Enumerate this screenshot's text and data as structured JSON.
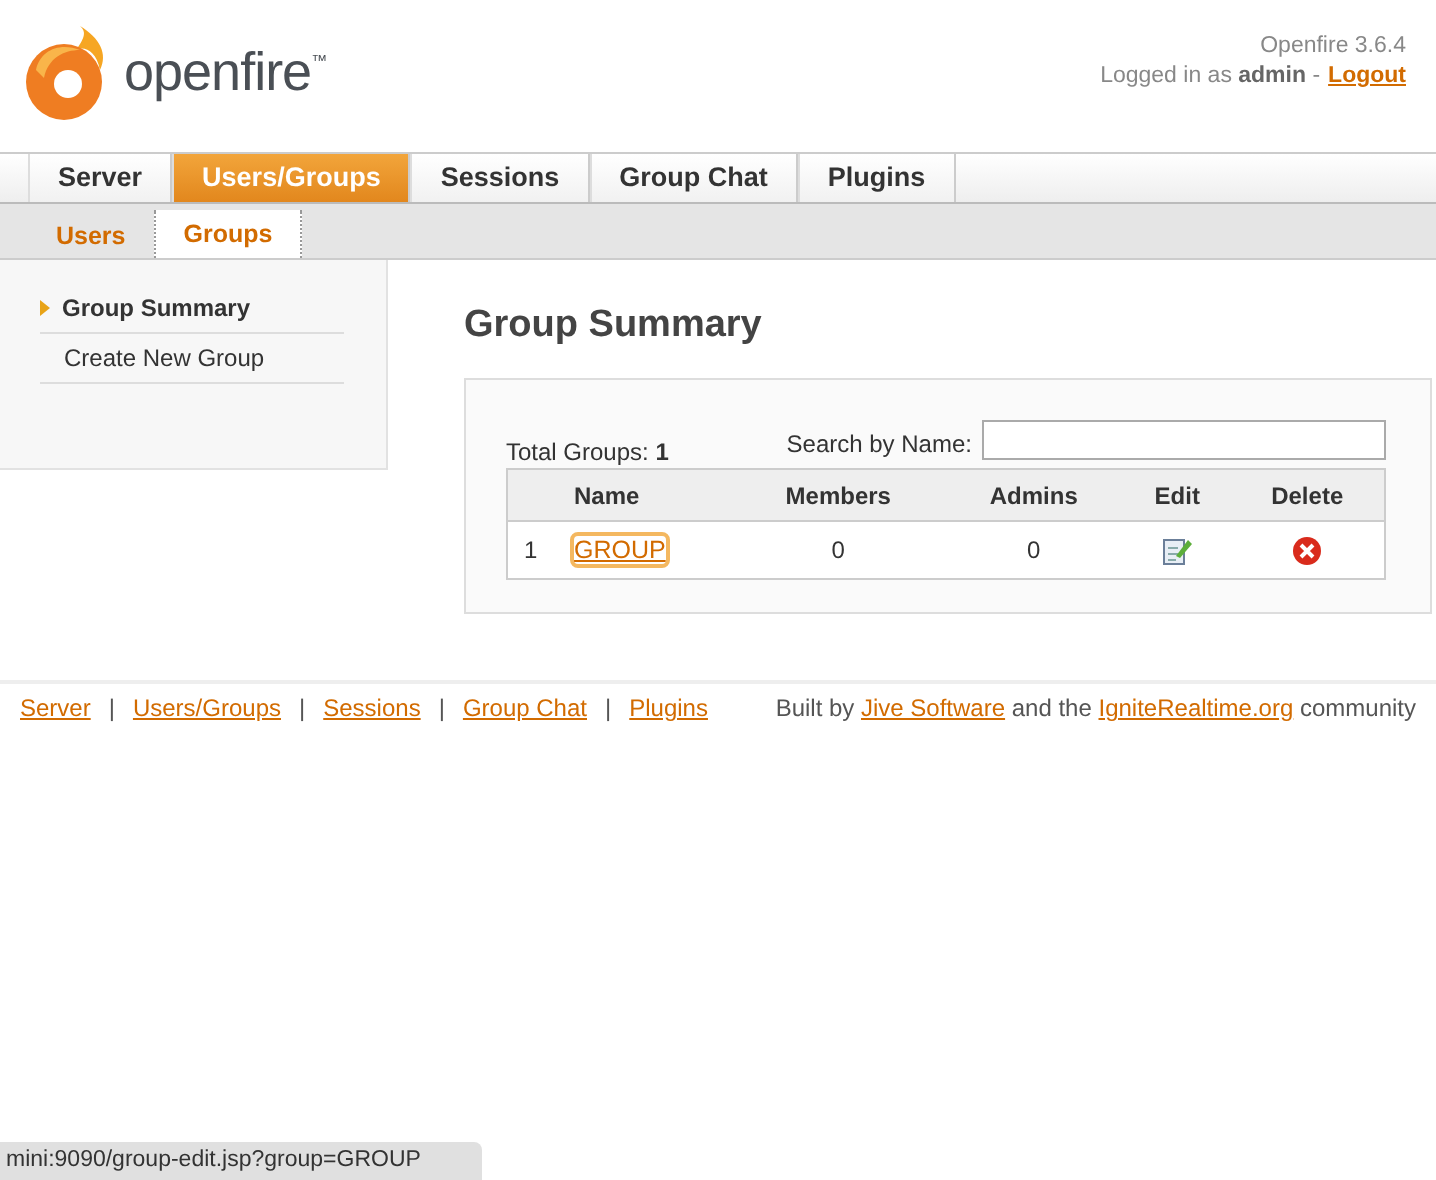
{
  "header": {
    "logo_text": "openfire",
    "trademark": "™",
    "version": "Openfire 3.6.4",
    "login_prefix": "Logged in as",
    "user": "admin",
    "separator": "-",
    "logout": "Logout"
  },
  "tabs": [
    {
      "label": "Server",
      "selected": false
    },
    {
      "label": "Users/Groups",
      "selected": true
    },
    {
      "label": "Sessions",
      "selected": false
    },
    {
      "label": "Group Chat",
      "selected": false
    },
    {
      "label": "Plugins",
      "selected": false
    }
  ],
  "subtabs": [
    {
      "label": "Users",
      "selected": false
    },
    {
      "label": "Groups",
      "selected": true
    }
  ],
  "sidebar": {
    "items": [
      {
        "label": "Group Summary",
        "selected": true
      },
      {
        "label": "Create New Group",
        "selected": false
      }
    ]
  },
  "page_title": "Group Summary",
  "summary": {
    "total_label": "Total Groups:",
    "total": "1",
    "search_label": "Search by Name:"
  },
  "table": {
    "columns": [
      "Name",
      "Members",
      "Admins",
      "Edit",
      "Delete"
    ],
    "rows": [
      {
        "index": "1",
        "name": "GROUP",
        "members": "0",
        "admins": "0",
        "focused": true
      }
    ]
  },
  "footer": {
    "links": [
      "Server",
      "Users/Groups",
      "Sessions",
      "Group Chat",
      "Plugins"
    ],
    "separator": "|",
    "credits": [
      {
        "kind": "text",
        "text": "Built by"
      },
      {
        "kind": "link",
        "text": "Jive Software"
      },
      {
        "kind": "text",
        "text": "and the"
      },
      {
        "kind": "link",
        "text": "IgniteRealtime.org"
      },
      {
        "kind": "text",
        "text": "community"
      }
    ]
  },
  "status_url": "mini:9090/group-edit.jsp?group=GROUP"
}
